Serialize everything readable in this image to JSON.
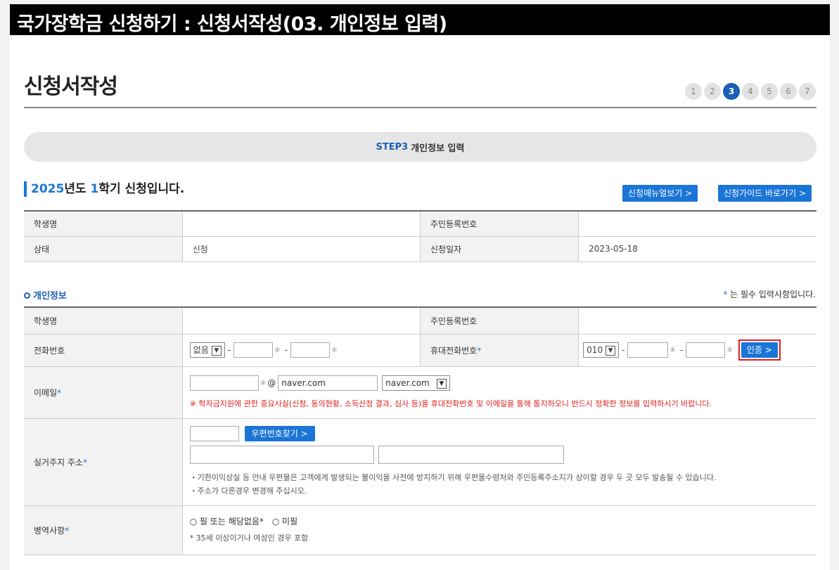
{
  "page_title": "국가장학금 신청하기 : 신청서작성(03. 개인정보 입력)",
  "heading": "신청서작성",
  "steps": [
    "1",
    "2",
    "3",
    "4",
    "5",
    "6",
    "7"
  ],
  "active_step": 3,
  "step_bar": {
    "step_label": "STEP3",
    "text": "개인정보 입력"
  },
  "semester": {
    "year": "2025",
    "mid1": "년도 ",
    "term": "1",
    "mid2": "학기 신청입니다."
  },
  "buttons": {
    "manual": "신청매뉴얼보기 >",
    "guide": "신청가이드 바로가기 >",
    "verify": "인증 >",
    "postcode": "우편번호찾기 >"
  },
  "summary": {
    "student_name_label": "학생명",
    "student_name": "",
    "resident_no_label": "주민등록번호",
    "resident_no": "",
    "status_label": "상태",
    "status": "신청",
    "apply_date_label": "신청일자",
    "apply_date": "2023-05-18"
  },
  "section_title": "개인정보",
  "required_note": "는 필수 입력사항입니다.",
  "form": {
    "name_label": "학생명",
    "name": "",
    "resident_label": "주민등록번호",
    "resident": "",
    "phone_label": "전화번호",
    "phone_area": "없음",
    "mobile_label": "휴대전화번호",
    "mobile_prefix": "010",
    "email_label": "이메일",
    "email_domain": "naver.com",
    "email_domain_select": "naver.com",
    "email_warning": "※ 학자금지원에 관한 중요사실(신청, 동의현황, 소득산정 결과, 심사 등)을 휴대전화번호 및 이메일을 통해 통지하오니 반드시 정확한 정보를 입력하시기 바랍니다.",
    "address_label": "실거주지 주소",
    "address_note1": "・기한이익상실 등 안내 우편물은 고객에게 발생되는 불이익을 사전에 방지하기 위해 우편물수령처와 주민등록주소지가 상이할 경우 두 곳 모두 발송될 수 있습니다.",
    "address_note2": "・주소가 다른경우 변경해 주십시오.",
    "military_label": "병역사항",
    "military_opt1": "필 또는 해당없음*",
    "military_opt2": "미필",
    "military_note": "* 35세 이상이거나 여성인 경우 포함"
  },
  "symbols": {
    "star": "*",
    "dash": "-",
    "at": "@"
  }
}
